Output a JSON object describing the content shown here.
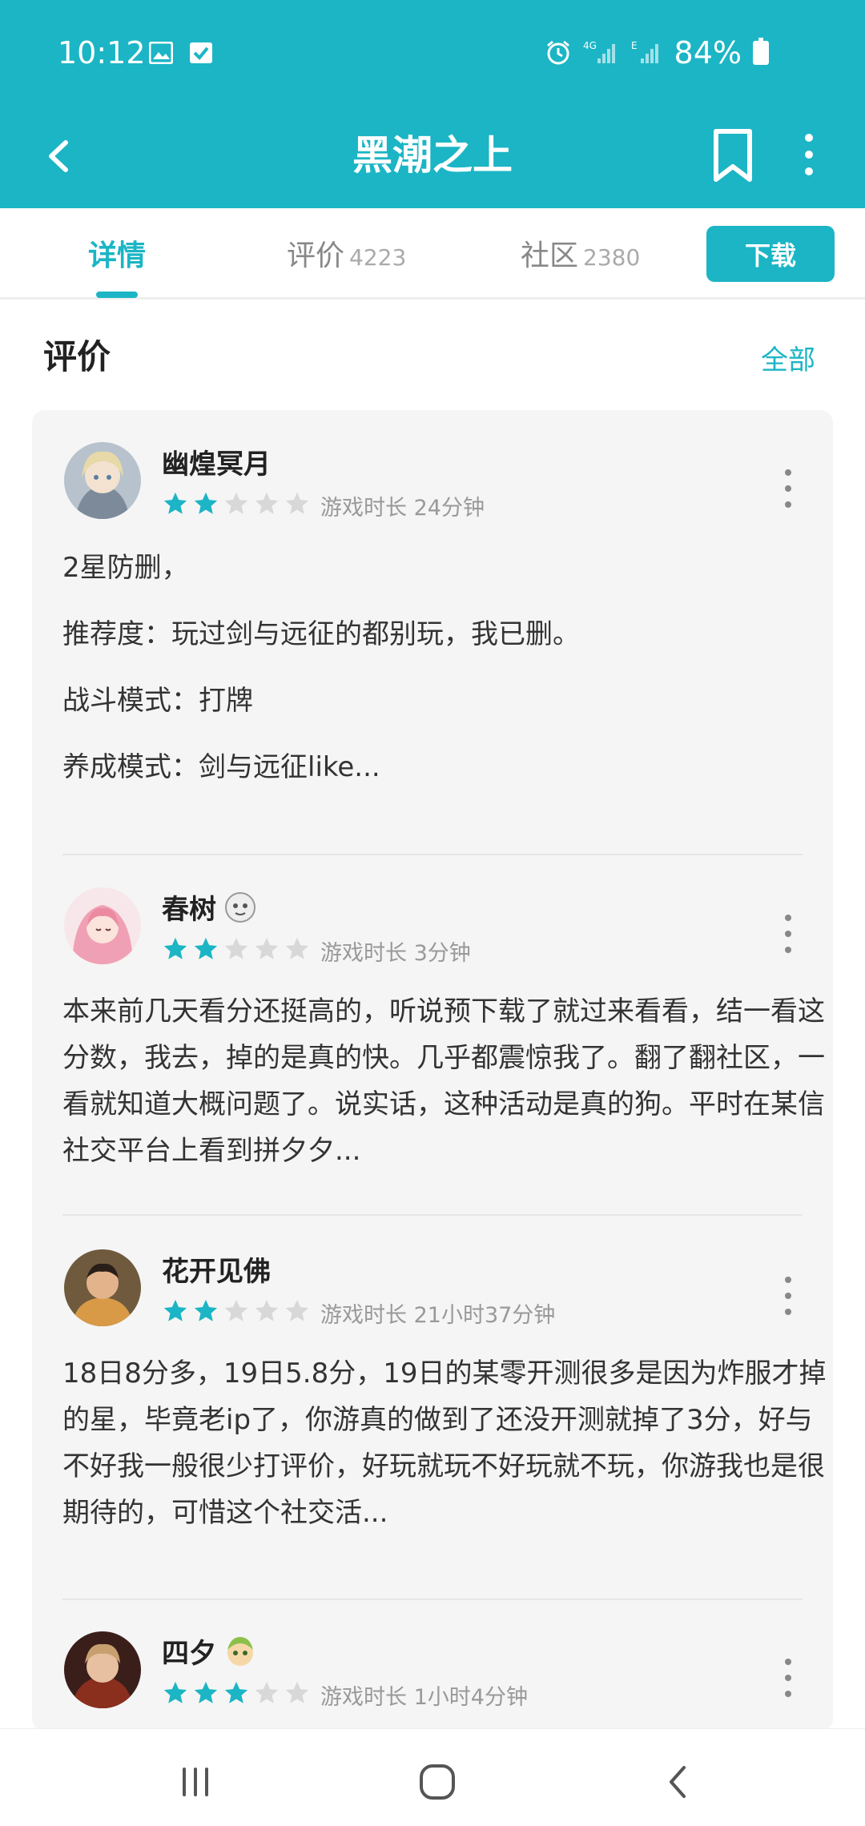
{
  "status_bar": {
    "time": "10:12",
    "battery": "84%",
    "icons": [
      "image-icon",
      "check-icon",
      "alarm-icon",
      "signal-4g-icon",
      "signal-e-icon",
      "battery-icon"
    ]
  },
  "app_bar": {
    "title": "黑潮之上",
    "icons": [
      "back-arrow-icon",
      "bookmark-icon",
      "more-vertical-icon"
    ]
  },
  "tabs": [
    {
      "label": "详情",
      "count": ""
    },
    {
      "label": "评价",
      "count": "4223"
    },
    {
      "label": "社区",
      "count": "2380"
    }
  ],
  "download_label": "下载",
  "section": {
    "title": "评价",
    "all_label": "全部"
  },
  "reviews": [
    {
      "username": "幽煌冥月",
      "rating": 2,
      "playtime": "游戏时长 24分钟",
      "body": [
        "2星防删，",
        "推荐度：玩过剑与远征的都别玩，我已删。",
        "战斗模式：打牌",
        "养成模式：剑与远征like..."
      ]
    },
    {
      "username": "春树",
      "rating": 2,
      "playtime": "游戏时长 3分钟",
      "body": [
        "本来前几天看分还挺高的，听说预下载了就过来看看，结一看这分数，我去，掉的是真的快。几乎都震惊我了。翻了翻社区，一看就知道大概问题了。说实话，这种活动是真的狗。平时在某信社交平台上看到拼夕夕..."
      ]
    },
    {
      "username": "花开见佛",
      "rating": 2,
      "playtime": "游戏时长 21小时37分钟",
      "body": [
        "18日8分多，19日5.8分，19日的某零开测很多是因为炸服才掉的星，毕竟老ip了，你游真的做到了还没开测就掉了3分，好与不好我一般很少打评价，好玩就玩不好玩就不玩，你游我也是很期待的，可惜这个社交活..."
      ]
    },
    {
      "username": "四夕",
      "rating": 3,
      "playtime": "游戏时长 1小时4分钟",
      "body": []
    }
  ],
  "colors": {
    "accent": "#1bb5c5",
    "star_filled": "#1bb5c5",
    "star_empty": "#d8d8d8",
    "card_bg": "#f5f5f5"
  },
  "nav_bar": {
    "icons": [
      "recent-apps-icon",
      "home-icon",
      "back-icon"
    ]
  }
}
